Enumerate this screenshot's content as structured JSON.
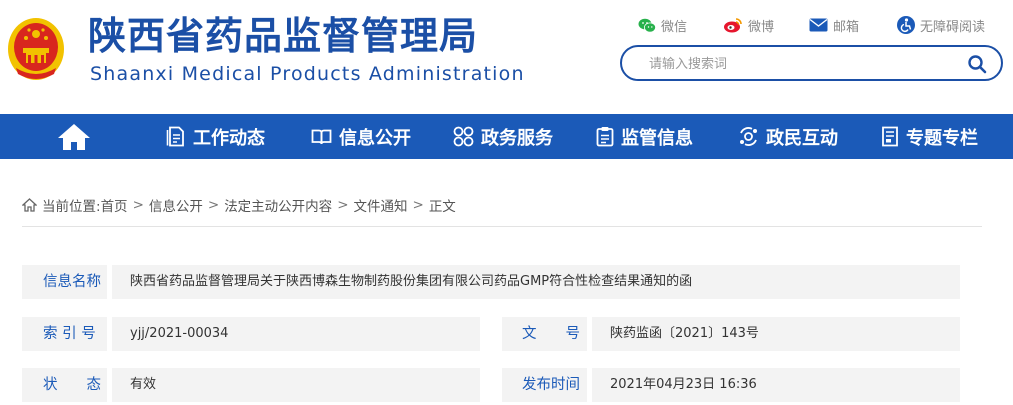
{
  "header": {
    "title_cn": "陕西省药品监督管理局",
    "title_en": "Shaanxi Medical Products Administration",
    "quick_links": {
      "wechat": "微信",
      "weibo": "微博",
      "mail": "邮箱",
      "accessibility": "无障碍阅读"
    },
    "search": {
      "placeholder": "请输入搜索词"
    }
  },
  "nav": {
    "items": [
      {
        "label": "工作动态",
        "icon": "document-icon"
      },
      {
        "label": "信息公开",
        "icon": "book-icon"
      },
      {
        "label": "政务服务",
        "icon": "grid-icon"
      },
      {
        "label": "监管信息",
        "icon": "clipboard-icon"
      },
      {
        "label": "政民互动",
        "icon": "interaction-icon"
      },
      {
        "label": "专题专栏",
        "icon": "folder-icon"
      }
    ]
  },
  "breadcrumb": {
    "prefix": "当前位置:",
    "items": [
      "首页",
      "信息公开",
      "法定主动公开内容",
      "文件通知",
      "正文"
    ],
    "separator": ">"
  },
  "info": {
    "name_label": "信息名称",
    "name_value": "陕西省药品监督管理局关于陕西博森生物制药股份集团有限公司药品GMP符合性检查结果通知的函",
    "index_label": "索 引 号",
    "index_value": "yjj/2021-00034",
    "docno_label": "文　　号",
    "docno_value": "陕药监函〔2021〕143号",
    "status_label": "状　　态",
    "status_value": "有效",
    "date_label": "发布时间",
    "date_value": "2021年04月23日 16:36"
  },
  "colors": {
    "brand_blue": "#1b5ab8",
    "logo_blue": "#1b4fa6",
    "emblem_red": "#d8261e",
    "emblem_gold": "#f2c200",
    "row_bg": "#f3f3f3"
  }
}
